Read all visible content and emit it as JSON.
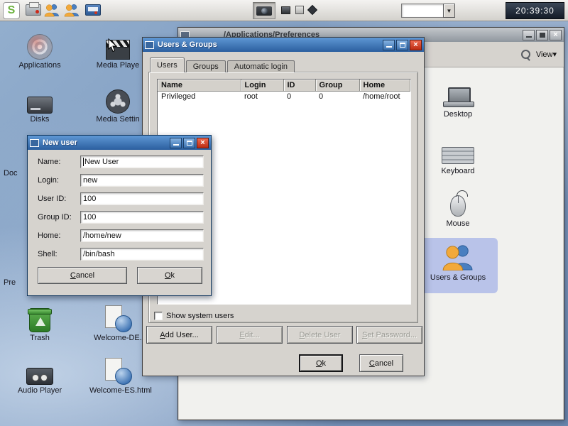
{
  "panel": {
    "logo_letter": "S",
    "clock": "20:39:30"
  },
  "desktop_icons": [
    {
      "label": "Applications"
    },
    {
      "label": "Media Playe"
    },
    {
      "label": "Disks"
    },
    {
      "label": "Media Settin"
    },
    {
      "label": "Doc"
    },
    {
      "label": "Pre"
    },
    {
      "label": "Trash"
    },
    {
      "label": "Welcome-DE."
    },
    {
      "label": "Audio Player"
    },
    {
      "label": "Welcome-ES.html"
    }
  ],
  "file_manager": {
    "title": "/Applications/Preferences",
    "view_label": "View",
    "items": [
      {
        "label": "Desktop"
      },
      {
        "label": "Keyboard"
      },
      {
        "label": "Mouse"
      },
      {
        "label": "Users & Groups"
      }
    ]
  },
  "users_groups": {
    "title": "Users & Groups",
    "tabs": [
      "Users",
      "Groups",
      "Automatic login"
    ],
    "columns": [
      "Name",
      "Login",
      "ID",
      "Group",
      "Home"
    ],
    "rows": [
      [
        "Privileged",
        "root",
        "0",
        "0",
        "/home/root"
      ]
    ],
    "show_system_users": "Show system users",
    "buttons": {
      "add_user": "Add User...",
      "edit": "Edit...",
      "delete_user": "Delete User",
      "set_password": "Set Password...",
      "ok": "Ok",
      "cancel": "Cancel"
    }
  },
  "new_user": {
    "title": "New user",
    "fields": [
      {
        "label": "Name:",
        "value": "New User"
      },
      {
        "label": "Login:",
        "value": "new"
      },
      {
        "label": "User ID:",
        "value": "100"
      },
      {
        "label": "Group ID:",
        "value": "100"
      },
      {
        "label": "Home:",
        "value": "/home/new"
      },
      {
        "label": "Shell:",
        "value": "/bin/bash"
      }
    ],
    "buttons": {
      "cancel": "Cancel",
      "ok": "Ok"
    }
  }
}
